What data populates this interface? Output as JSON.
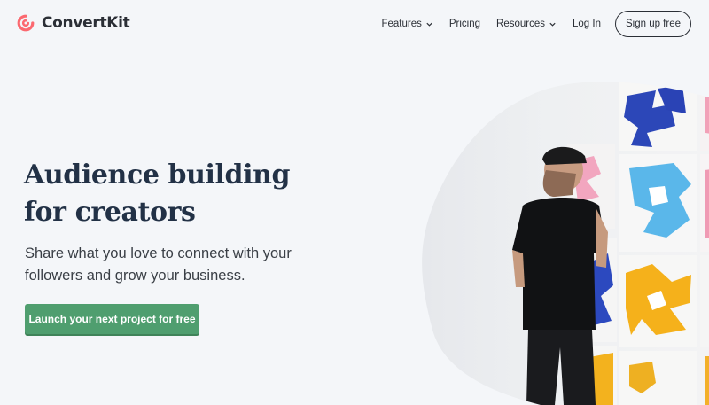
{
  "brand": {
    "name": "ConvertKit",
    "accent": "#fb6970"
  },
  "nav": {
    "features": "Features",
    "pricing": "Pricing",
    "resources": "Resources",
    "login": "Log In",
    "signup": "Sign up free"
  },
  "hero": {
    "headline": "Audience building for creators",
    "subhead": "Share what you love to connect with your followers and grow your business.",
    "cta": "Launch your next project for free",
    "cta_color": "#4f9e6f",
    "image": "artist-painting-wall-photo"
  }
}
